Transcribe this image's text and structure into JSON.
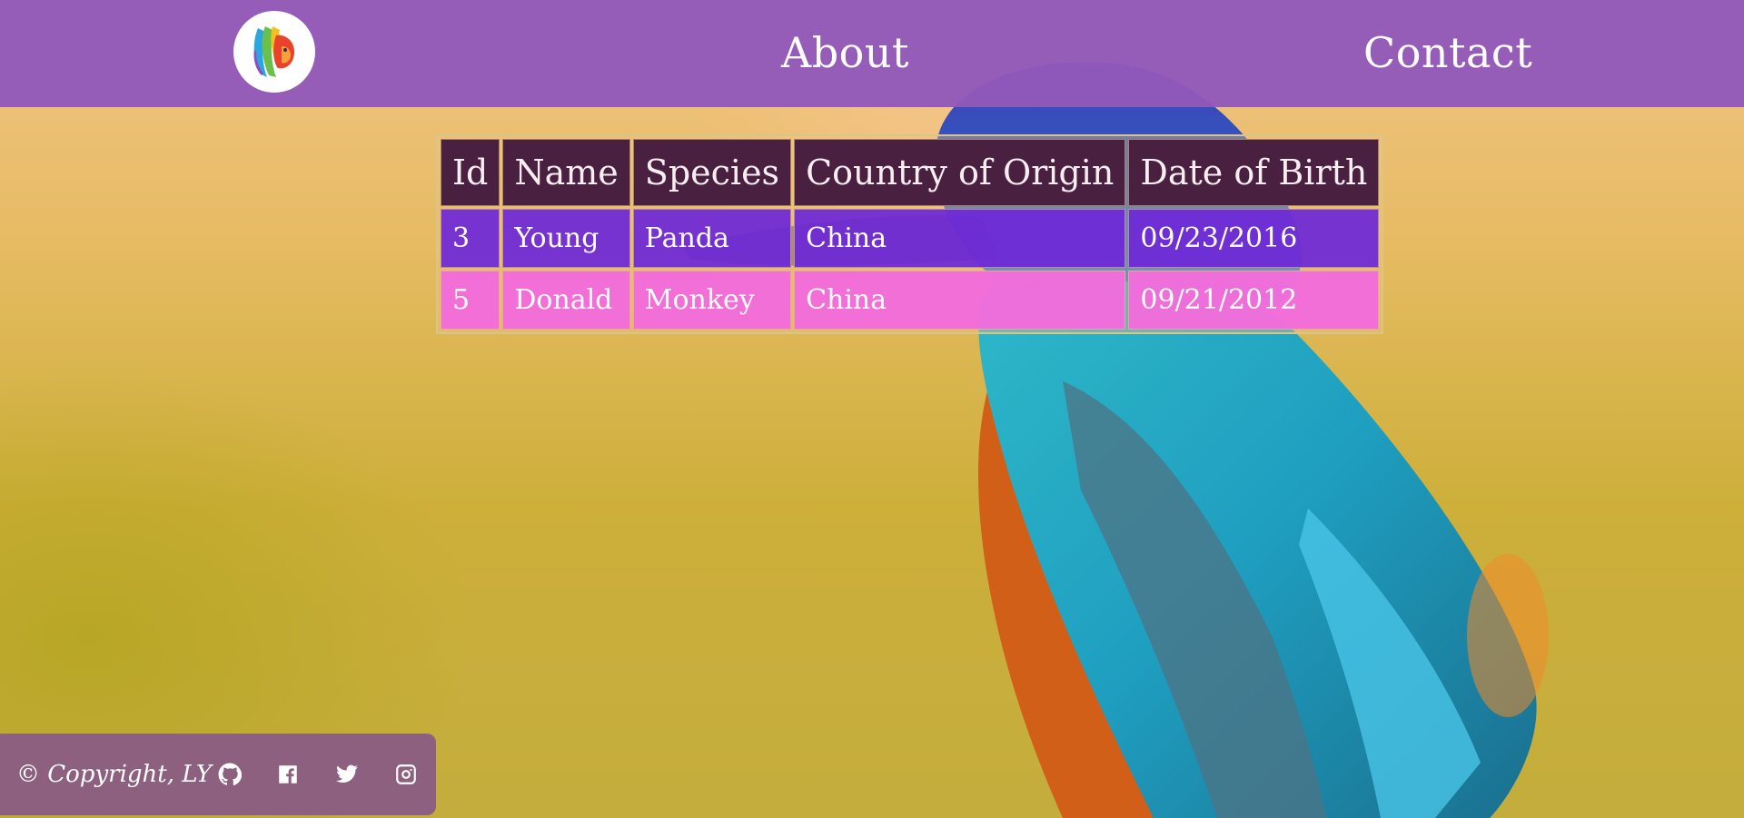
{
  "header": {
    "logo_icon": "lion-logo-icon",
    "nav": [
      {
        "label": "About"
      },
      {
        "label": "Contact"
      }
    ],
    "background_color": "#9258ba"
  },
  "table": {
    "columns": [
      "Id",
      "Name",
      "Species",
      "Country of Origin",
      "Date of Birth"
    ],
    "rows": [
      [
        "3",
        "Young",
        "Panda",
        "China",
        "09/23/2016"
      ],
      [
        "5",
        "Donald",
        "Monkey",
        "China",
        "09/21/2012"
      ]
    ],
    "header_color": "#4a2040",
    "row_colors": [
      "#6e28d7",
      "#f26cdc"
    ]
  },
  "footer": {
    "copyright": "© Copyright, LY",
    "social_icons": [
      "github-icon",
      "facebook-icon",
      "twitter-icon",
      "instagram-icon"
    ],
    "background_color": "#8a5c84"
  },
  "background": {
    "image": "kingfisher-bird-icon"
  }
}
